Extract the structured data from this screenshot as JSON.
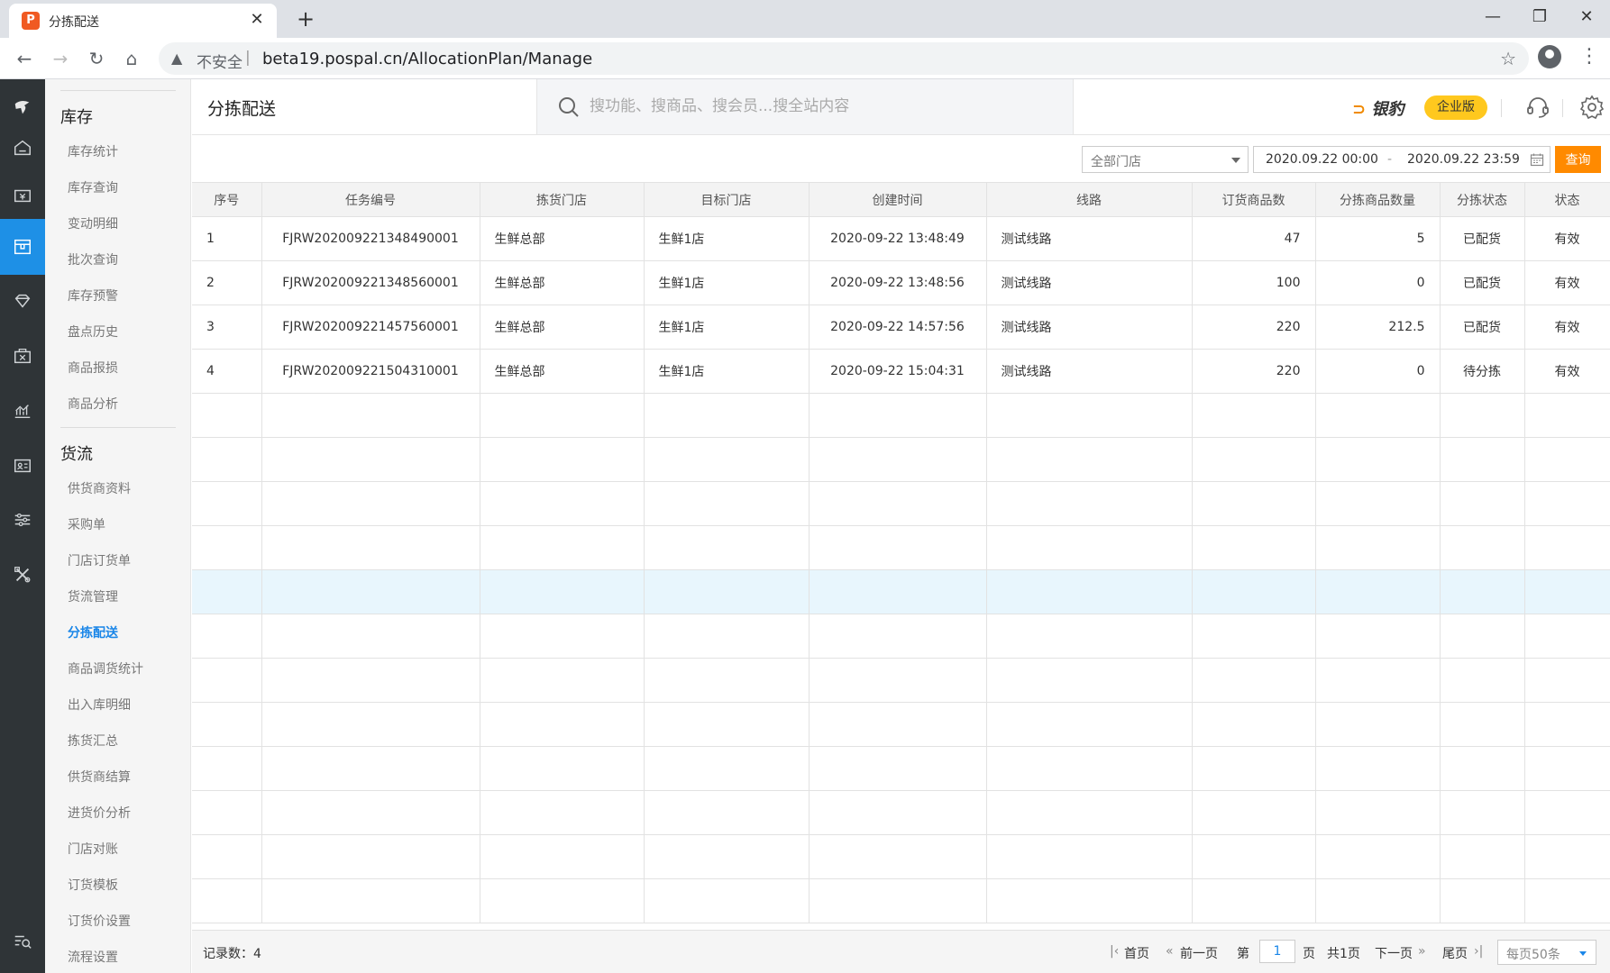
{
  "browser": {
    "tab_title": "分拣配送",
    "tab_close": "✕",
    "new_tab": "+",
    "win_min": "—",
    "win_max": "❐",
    "win_close": "✕",
    "back": "←",
    "forward": "→",
    "reload": "↻",
    "home": "⌂",
    "insecure_label": "不安全",
    "separator": "|",
    "url": "beta19.pospal.cn/AllocationPlan/Manage",
    "star": "☆",
    "menu": "⋮"
  },
  "sidebar": {
    "sections": [
      {
        "title": "库存",
        "items": [
          "库存统计",
          "库存查询",
          "变动明细",
          "批次查询",
          "库存预警",
          "盘点历史",
          "商品报损",
          "商品分析"
        ]
      },
      {
        "title": "货流",
        "items": [
          "供货商资料",
          "采购单",
          "门店订货单",
          "货流管理",
          "分拣配送",
          "商品调货统计",
          "出入库明细",
          "拣货汇总",
          "供货商结算",
          "进货价分析",
          "门店对账",
          "订货模板",
          "订货价设置",
          "流程设置"
        ]
      }
    ],
    "active_item": "分拣配送"
  },
  "header": {
    "page_title": "分拣配送",
    "search_placeholder": "搜功能、搜商品、搜会员...搜全站内容",
    "brand_name": "银豹",
    "edition_badge": "企业版"
  },
  "toolbar": {
    "store_select_value": "全部门店",
    "date_start": "2020.09.22 00:00",
    "date_separator": "-",
    "date_end": "2020.09.22 23:59",
    "query_button": "查询"
  },
  "table": {
    "columns": [
      "序号",
      "任务编号",
      "拣货门店",
      "目标门店",
      "创建时间",
      "线路",
      "订货商品数",
      "分拣商品数量",
      "分拣状态",
      "状态"
    ],
    "rows": [
      [
        "1",
        "FJRW202009221348490001",
        "生鲜总部",
        "生鲜1店",
        "2020-09-22 13:48:49",
        "测试线路",
        "47",
        "5",
        "已配货",
        "有效"
      ],
      [
        "2",
        "FJRW202009221348560001",
        "生鲜总部",
        "生鲜1店",
        "2020-09-22 13:48:56",
        "测试线路",
        "100",
        "0",
        "已配货",
        "有效"
      ],
      [
        "3",
        "FJRW202009221457560001",
        "生鲜总部",
        "生鲜1店",
        "2020-09-22 14:57:56",
        "测试线路",
        "220",
        "212.5",
        "已配货",
        "有效"
      ],
      [
        "4",
        "FJRW202009221504310001",
        "生鲜总部",
        "生鲜1店",
        "2020-09-22 15:04:31",
        "测试线路",
        "220",
        "0",
        "待分拣",
        "有效"
      ]
    ],
    "empty_rows": 12,
    "highlighted_empty_row": 4
  },
  "footer": {
    "record_label": "记录数：",
    "record_count": "4",
    "first_page": "首页",
    "prev_page": "前一页",
    "page_prefix": "第",
    "current_page": "1",
    "page_suffix": "页",
    "total_pages": "共1页",
    "next_page": "下一页",
    "last_page": "尾页",
    "page_size": "每页50条"
  },
  "colors": {
    "accent": "#1e90e6",
    "query_button": "#ff8a00",
    "badge": "#ffc81e",
    "iconbar": "#2f3437",
    "row_highlight": "#e8f6fd"
  }
}
